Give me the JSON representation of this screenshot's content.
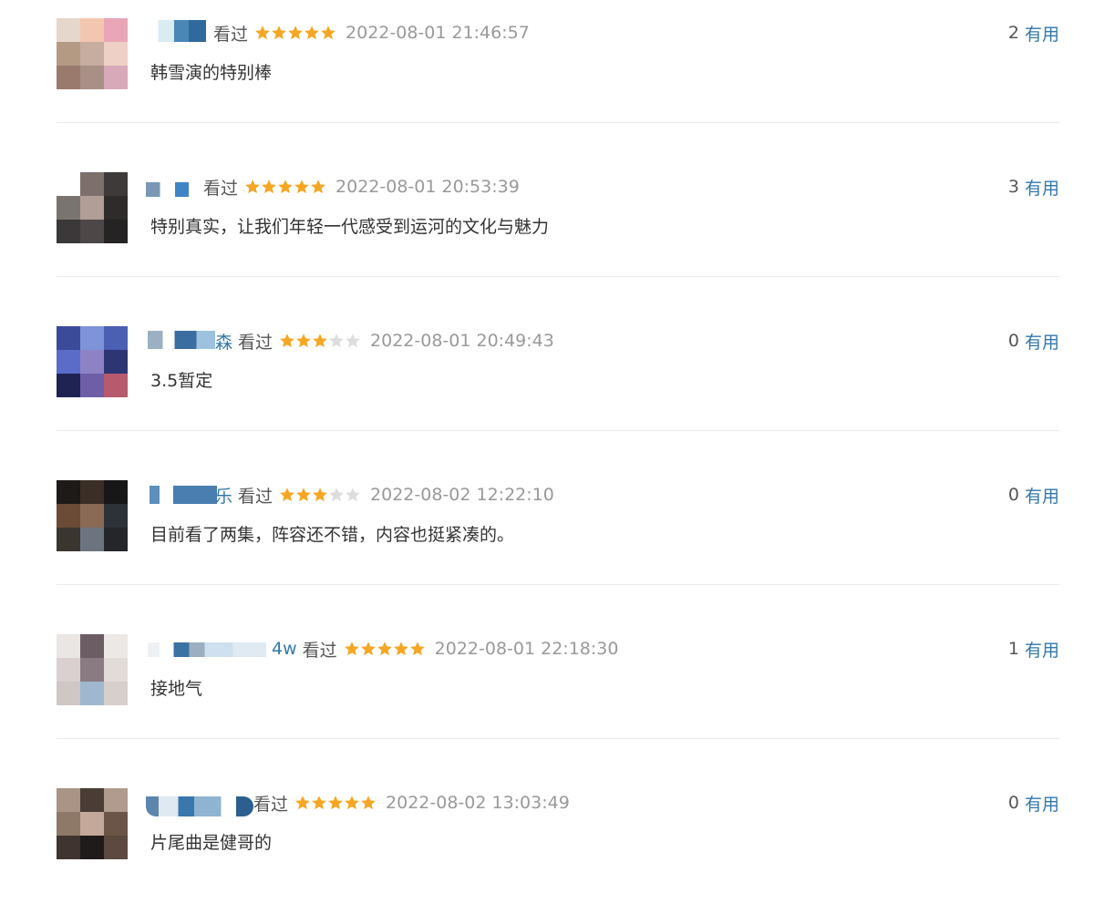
{
  "comments": [
    {
      "name_suffix": "",
      "watched": "看过",
      "rating": 5,
      "time": "2022-08-01 21:46:57",
      "votes": "2",
      "useful": "有用",
      "text": "韩雪演的特别棒"
    },
    {
      "name_suffix": "",
      "watched": "看过",
      "rating": 5,
      "time": "2022-08-01 20:53:39",
      "votes": "3",
      "useful": "有用",
      "text": "特别真实，让我们年轻一代感受到运河的文化与魅力"
    },
    {
      "name_suffix": "森",
      "watched": "看过",
      "rating": 3,
      "time": "2022-08-01 20:49:43",
      "votes": "0",
      "useful": "有用",
      "text": "3.5暂定"
    },
    {
      "name_suffix": "乐",
      "watched": "看过",
      "rating": 3,
      "time": "2022-08-02 12:22:10",
      "votes": "0",
      "useful": "有用",
      "text": "目前看了两集，阵容还不错，内容也挺紧凑的。"
    },
    {
      "name_suffix": "4w",
      "watched": "看过",
      "rating": 5,
      "time": "2022-08-01 22:18:30",
      "votes": "1",
      "useful": "有用",
      "text": "接地气"
    },
    {
      "name_suffix": "",
      "watched": "看过",
      "rating": 5,
      "time": "2022-08-02 13:03:49",
      "votes": "0",
      "useful": "有用",
      "text": "片尾曲是健哥的"
    }
  ],
  "colors": {
    "star_on": "#f5a623",
    "star_off": "#dddddd",
    "link": "#3377aa",
    "muted": "#999999"
  }
}
